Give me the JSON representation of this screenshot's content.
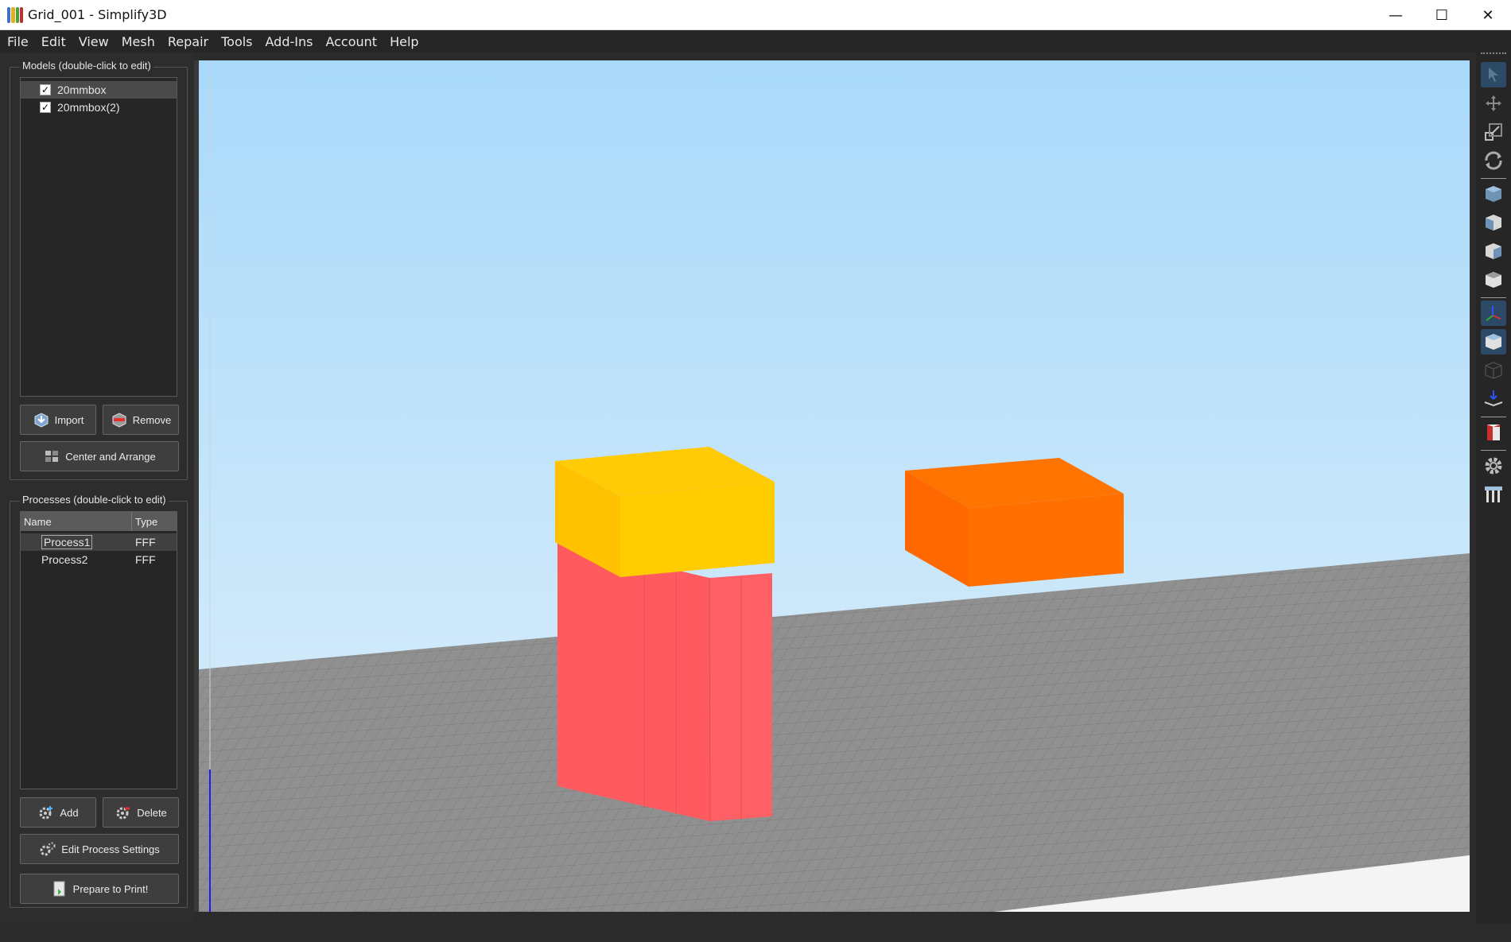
{
  "window": {
    "title": "Grid_001 - Simplify3D"
  },
  "menu": [
    "File",
    "Edit",
    "View",
    "Mesh",
    "Repair",
    "Tools",
    "Add-Ins",
    "Account",
    "Help"
  ],
  "models_panel": {
    "title": "Models (double-click to edit)",
    "items": [
      {
        "name": "20mmbox",
        "checked": true,
        "selected": true
      },
      {
        "name": "20mmbox(2)",
        "checked": true,
        "selected": false
      }
    ],
    "import_label": "Import",
    "remove_label": "Remove",
    "center_label": "Center and Arrange"
  },
  "processes_panel": {
    "title": "Processes (double-click to edit)",
    "columns": [
      "Name",
      "Type"
    ],
    "rows": [
      {
        "name": "Process1",
        "type": "FFF",
        "selected": true
      },
      {
        "name": "Process2",
        "type": "FFF",
        "selected": false
      }
    ],
    "add_label": "Add",
    "delete_label": "Delete",
    "edit_label": "Edit Process Settings",
    "prepare_label": "Prepare to Print!"
  },
  "viewport": {
    "axis_label": "Z",
    "colors": {
      "sky_top": "#a9d9fa",
      "sky_bottom": "#dff0fb",
      "bed": "#8f8f8f",
      "model_top": "#ffcc00",
      "model_bottom": "#ff5a5f",
      "model_right": "#ff7000"
    }
  },
  "right_toolbar": {
    "icons": [
      "select-arrow-icon",
      "move-icon",
      "scale-icon",
      "rotate-icon",
      "view-default-icon",
      "view-front-icon",
      "view-side-icon",
      "view-top-icon",
      "axes-icon",
      "solid-view-icon",
      "wireframe-icon",
      "cross-section-icon",
      "gcode-preview-icon",
      "settings-gear-icon",
      "supports-icon"
    ]
  }
}
